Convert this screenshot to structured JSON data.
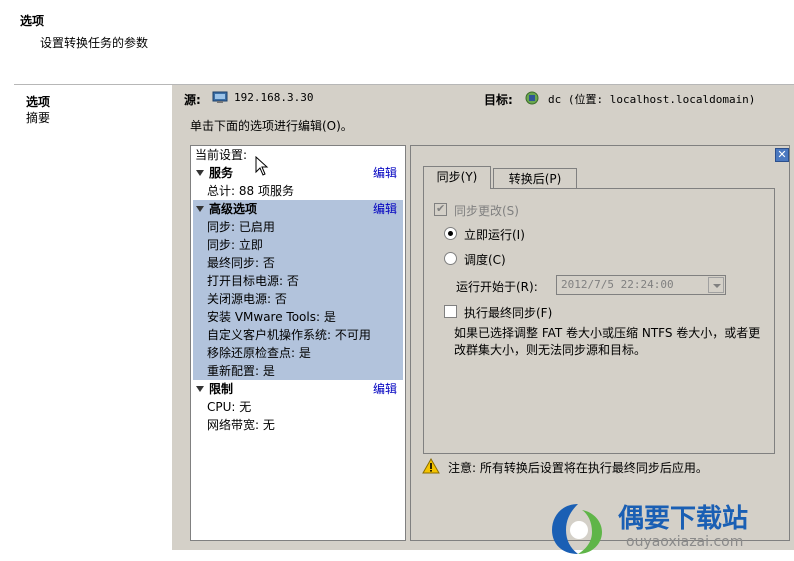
{
  "header": {
    "title": "选项",
    "subtitle": "设置转换任务的参数"
  },
  "nav": {
    "items": [
      {
        "label": "选项",
        "active": true
      },
      {
        "label": "摘要",
        "active": false
      }
    ]
  },
  "main": {
    "source_label": "源:",
    "source_value": "192.168.3.30",
    "target_label": "目标:",
    "target_value": "dc (位置: localhost.localdomain)",
    "instruction": "单击下面的选项进行编辑(O)。"
  },
  "settings_list": {
    "header": "当前设置:",
    "edit_label": "编辑",
    "groups": [
      {
        "title": "服务",
        "items": [
          "总计: 88 项服务"
        ]
      },
      {
        "title": "高级选项",
        "items": [
          "同步: 已启用",
          "同步: 立即",
          "最终同步: 否",
          "打开目标电源: 否",
          "关闭源电源: 否",
          "安装 VMware Tools: 是",
          "自定义客户机操作系统: 不可用",
          "移除还原检查点: 是",
          "重新配置: 是"
        ]
      },
      {
        "title": "限制",
        "items": [
          "CPU: 无",
          "网络带宽: 无"
        ]
      }
    ]
  },
  "options_panel": {
    "close_icon": "close-icon",
    "tabs": [
      {
        "label": "同步(Y)",
        "active": true
      },
      {
        "label": "转换后(P)",
        "active": false
      }
    ],
    "sync_changes": {
      "label": "同步更改(S)",
      "checked": true,
      "disabled": true
    },
    "run_now": {
      "label": "立即运行(I)",
      "selected": true
    },
    "schedule": {
      "label": "调度(C)",
      "selected": false
    },
    "run_start_label": "运行开始于(R):",
    "run_start_value": "2012/7/5 22:24:00",
    "final_sync": {
      "label": "执行最终同步(F)",
      "checked": false
    },
    "note": "如果已选择调整 FAT 卷大小或压缩 NTFS 卷大小，或者更改群集大小，则无法同步源和目标。"
  },
  "footer_note": "注意: 所有转换后设置将在执行最终同步后应用。",
  "watermark": {
    "title": "偶要下载站",
    "url": "ouyaoxiazai.com"
  },
  "colors": {
    "panel_bg": "#d4d0c8",
    "selection": "#b2c3dc",
    "link": "#0000c0",
    "watermark_blue": "#1a5fb4"
  }
}
